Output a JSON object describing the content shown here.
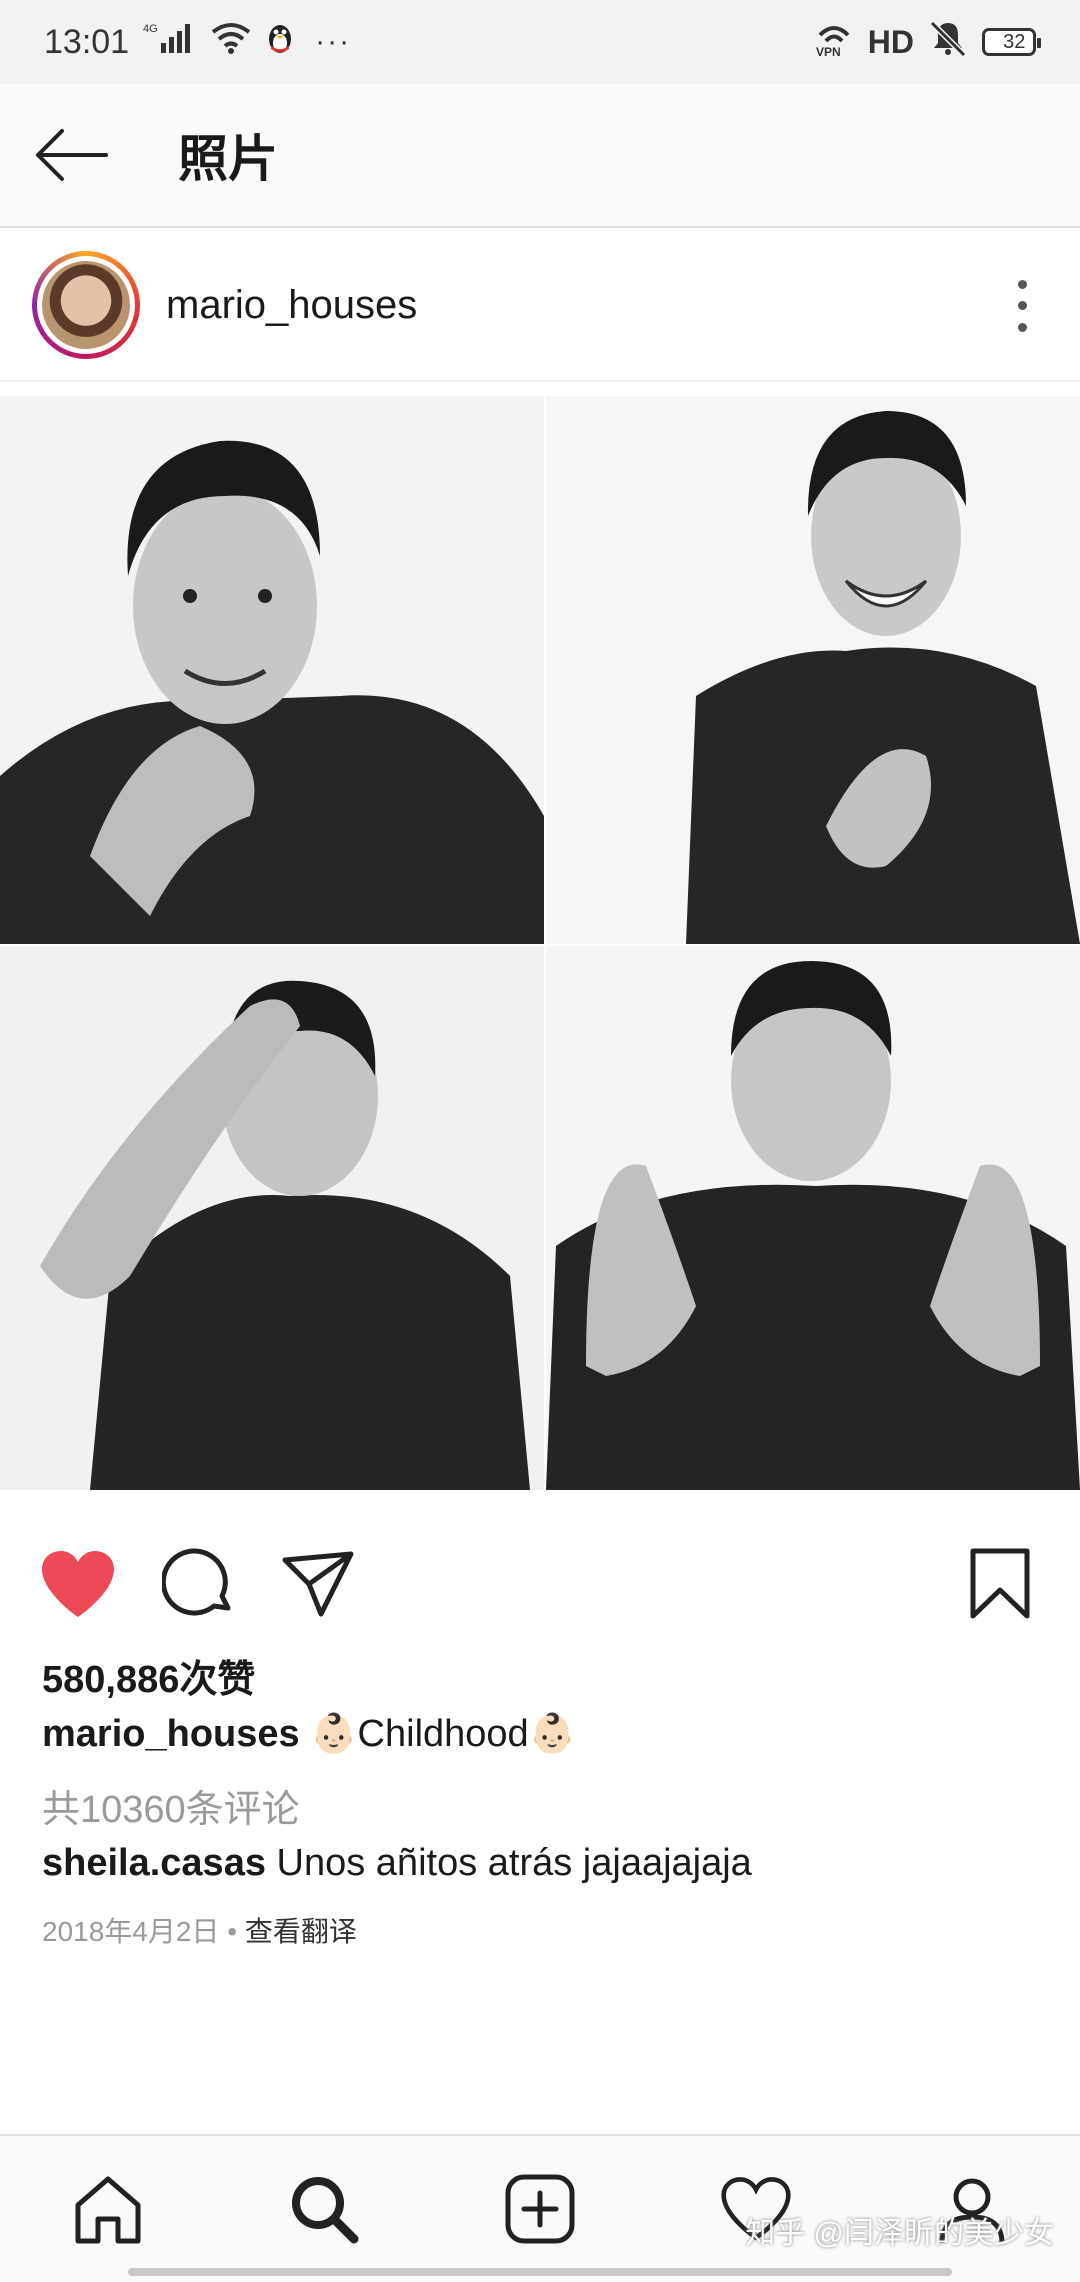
{
  "status_bar": {
    "time": "13:01",
    "network": "4G",
    "dots": "···",
    "vpn": "VPN",
    "hd": "HD",
    "battery": "32"
  },
  "header": {
    "title": "照片"
  },
  "post": {
    "username": "mario_houses",
    "photos": [
      "photo-1",
      "photo-2",
      "photo-3",
      "photo-4"
    ]
  },
  "actions": {
    "like_icon": "heart-filled-icon",
    "comment_icon": "comment-icon",
    "share_icon": "send-icon",
    "save_icon": "bookmark-icon",
    "like_color": "#ed4956"
  },
  "likes": "580,886次赞",
  "caption": {
    "username": "mario_houses",
    "emoji_1": "👶🏻",
    "text": "Childhood",
    "emoji_2": "👶🏻"
  },
  "comments_link": "共10360条评论",
  "comment": {
    "username": "sheila.casas",
    "text": "Unos añitos atrás jajaajajaja"
  },
  "meta": {
    "date": "2018年4月2日",
    "separator": " • ",
    "translate": "查看翻译"
  },
  "bottom_nav": [
    "home-icon",
    "search-icon",
    "add-post-icon",
    "activity-icon",
    "profile-icon"
  ],
  "watermark": "知乎 @闫泽昕的美少女"
}
